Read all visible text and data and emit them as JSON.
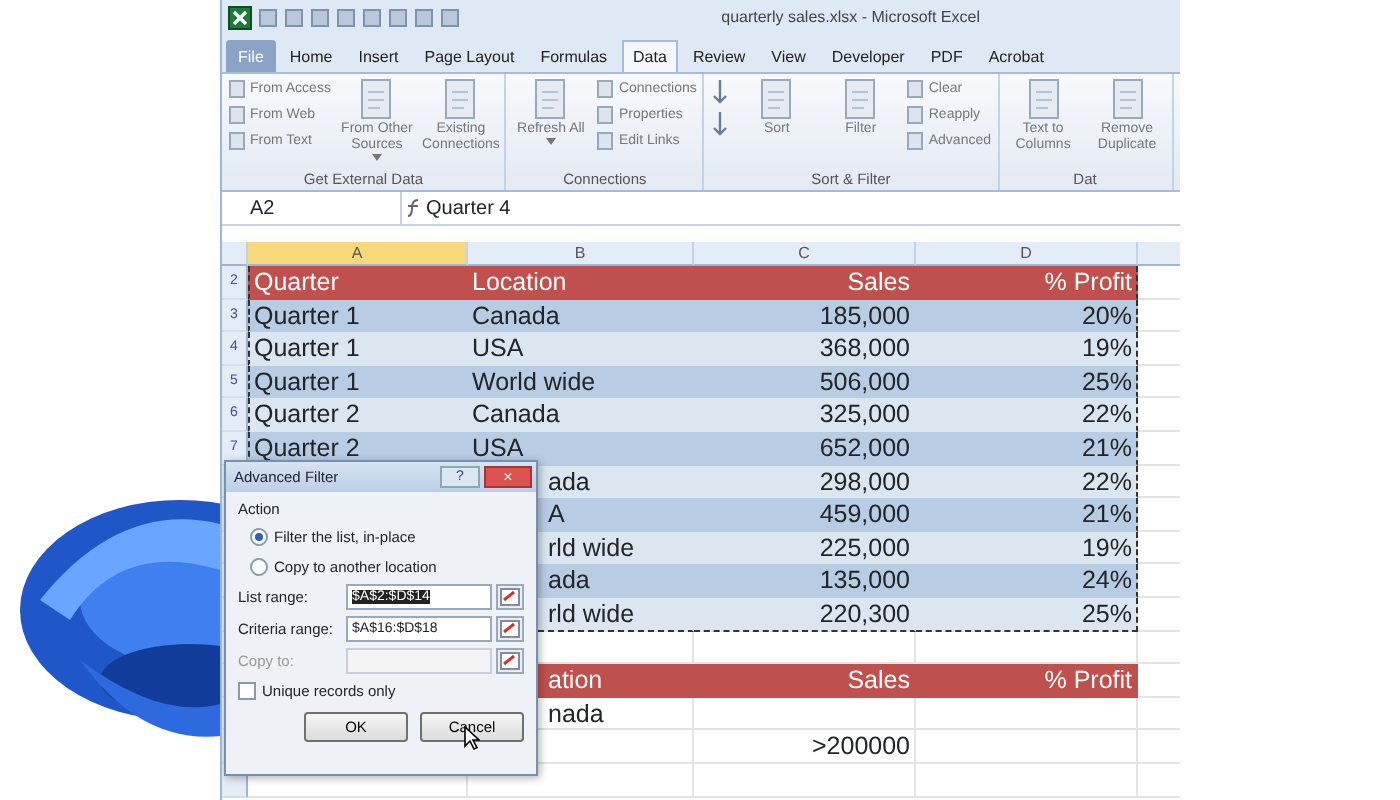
{
  "window": {
    "title": "quarterly sales.xlsx - Microsoft Excel"
  },
  "tabs": [
    {
      "label": "File",
      "kind": "file",
      "selected": false
    },
    {
      "label": "Home",
      "selected": false
    },
    {
      "label": "Insert",
      "selected": false
    },
    {
      "label": "Page Layout",
      "selected": false
    },
    {
      "label": "Formulas",
      "selected": false
    },
    {
      "label": "Data",
      "selected": true
    },
    {
      "label": "Review",
      "selected": false
    },
    {
      "label": "View",
      "selected": false
    },
    {
      "label": "Developer",
      "selected": false
    },
    {
      "label": "PDF",
      "selected": false
    },
    {
      "label": "Acrobat",
      "selected": false
    }
  ],
  "ribbon_groups": [
    {
      "label": "Get External Data",
      "items": [
        {
          "kind": "small",
          "label": "From Access"
        },
        {
          "kind": "small",
          "label": "From Web"
        },
        {
          "kind": "small",
          "label": "From Text"
        },
        {
          "kind": "large",
          "label": "From Other Sources",
          "dropdown": true
        },
        {
          "kind": "large",
          "label": "Existing Connections"
        }
      ]
    },
    {
      "label": "Connections",
      "items": [
        {
          "kind": "large",
          "label": "Refresh All",
          "dropdown": true
        },
        {
          "kind": "small",
          "label": "Connections"
        },
        {
          "kind": "small",
          "label": "Properties"
        },
        {
          "kind": "small",
          "label": "Edit Links"
        }
      ]
    },
    {
      "label": "Sort & Filter",
      "items": [
        {
          "kind": "icon"
        },
        {
          "kind": "icon"
        },
        {
          "kind": "large",
          "label": "Sort"
        },
        {
          "kind": "large",
          "label": "Filter"
        },
        {
          "kind": "small",
          "label": "Clear"
        },
        {
          "kind": "small",
          "label": "Reapply"
        },
        {
          "kind": "small",
          "label": "Advanced"
        }
      ]
    },
    {
      "label": "Dat",
      "items": [
        {
          "kind": "large",
          "label": "Text to Columns"
        },
        {
          "kind": "large",
          "label": "Remove Duplicate"
        }
      ]
    }
  ],
  "formula_bar": {
    "name_box": "A2",
    "formula": "Quarter 4"
  },
  "sheet": {
    "columns": [
      {
        "label": "A",
        "selected": true
      },
      {
        "label": "B",
        "selected": false
      },
      {
        "label": "C",
        "selected": false
      },
      {
        "label": "D",
        "selected": false
      }
    ],
    "rows": [
      {
        "number": "2",
        "kind": "header",
        "in_range": true,
        "cells": [
          "Quarter",
          "Location",
          "Sales",
          "% Profit"
        ]
      },
      {
        "number": "3",
        "kind": "data",
        "in_range": true,
        "cells": [
          "Quarter 1",
          "Canada",
          "185,000",
          "20%"
        ]
      },
      {
        "number": "4",
        "kind": "data",
        "in_range": true,
        "cells": [
          "Quarter 1",
          "USA",
          "368,000",
          "19%"
        ]
      },
      {
        "number": "5",
        "kind": "data",
        "in_range": true,
        "cells": [
          "Quarter 1",
          "World wide",
          "506,000",
          "25%"
        ]
      },
      {
        "number": "6",
        "kind": "data",
        "in_range": true,
        "cells": [
          "Quarter 2",
          "Canada",
          "325,000",
          "22%"
        ]
      },
      {
        "number": "7",
        "kind": "data",
        "in_range": true,
        "cells": [
          "Quarter 2",
          "USA",
          "652,000",
          "21%"
        ]
      },
      {
        "kind": "data",
        "in_range": true,
        "cells": [
          "",
          "ada",
          "298,000",
          "22%"
        ]
      },
      {
        "kind": "data",
        "in_range": true,
        "cells": [
          "",
          "A",
          "459,000",
          "21%"
        ]
      },
      {
        "kind": "data",
        "in_range": true,
        "cells": [
          "",
          "rld wide",
          "225,000",
          "19%"
        ]
      },
      {
        "kind": "data",
        "in_range": true,
        "cells": [
          "",
          "ada",
          "135,000",
          "24%"
        ]
      },
      {
        "kind": "data",
        "in_range": true,
        "cells": [
          "",
          "rld wide",
          "220,300",
          "25%"
        ]
      },
      {
        "kind": "blank",
        "in_range": false,
        "cells": [
          "",
          "",
          "",
          ""
        ]
      },
      {
        "kind": "header",
        "in_range": false,
        "cells": [
          "",
          "ation",
          "Sales",
          "% Profit"
        ]
      },
      {
        "kind": "plain",
        "in_range": false,
        "cells": [
          "",
          "nada",
          "",
          ""
        ]
      },
      {
        "kind": "plain",
        "in_range": false,
        "cells": [
          "",
          "",
          ">200000",
          ""
        ]
      },
      {
        "kind": "blank",
        "in_range": false,
        "cells": [
          "",
          "",
          "",
          ""
        ]
      }
    ]
  },
  "dialog": {
    "title": "Advanced Filter",
    "help": "?",
    "close": "×",
    "group": "Action",
    "radios": [
      {
        "label": "Filter the list, in-place",
        "selected": true
      },
      {
        "label": "Copy to another location",
        "selected": false
      }
    ],
    "fields": [
      {
        "label": "List range:",
        "value": "$A$2:$D$14",
        "highlighted": true,
        "disabled": false
      },
      {
        "label": "Criteria range:",
        "value": "$A$16:$D$18",
        "highlighted": false,
        "disabled": false
      },
      {
        "label": "Copy to:",
        "disabled": true
      }
    ],
    "unique_records": {
      "label": "Unique records only",
      "checked": false
    },
    "buttons": [
      "OK",
      "Cancel"
    ]
  }
}
